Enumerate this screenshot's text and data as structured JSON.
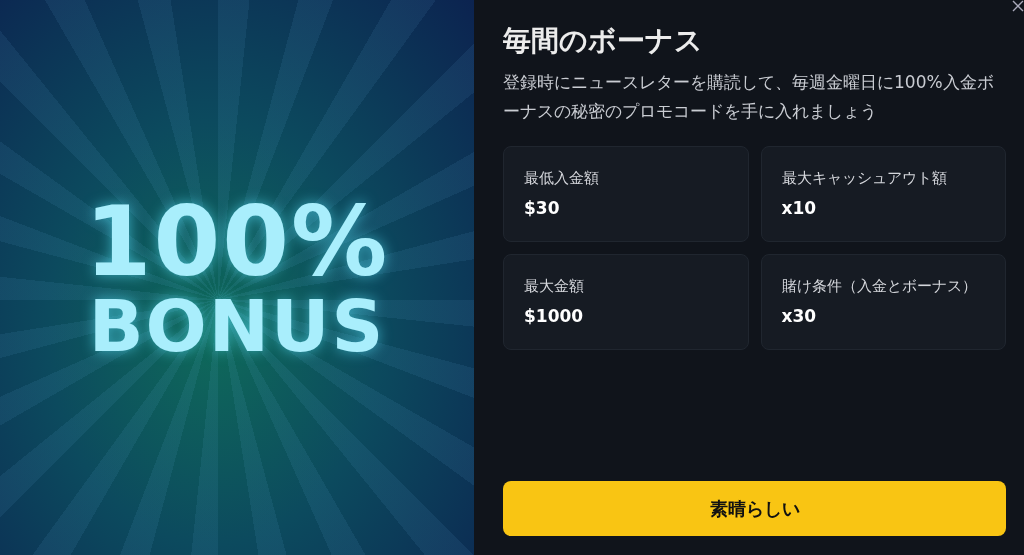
{
  "banner": {
    "line_1": "100%",
    "line_2": "BONUS"
  },
  "title": "毎間のボーナス",
  "description": "登録時にニュースレターを購読して、毎週金曜日に100%入金ボーナスの秘密のプロモコードを手に入れましょう",
  "stats": [
    {
      "label": "最低入金額",
      "value": "$30"
    },
    {
      "label": "最大キャッシュアウト額",
      "value": "x10"
    },
    {
      "label": "最大金額",
      "value": "$1000"
    },
    {
      "label": "賭け条件（入金とボーナス）",
      "value": "x30"
    }
  ],
  "button": "素晴らしい"
}
